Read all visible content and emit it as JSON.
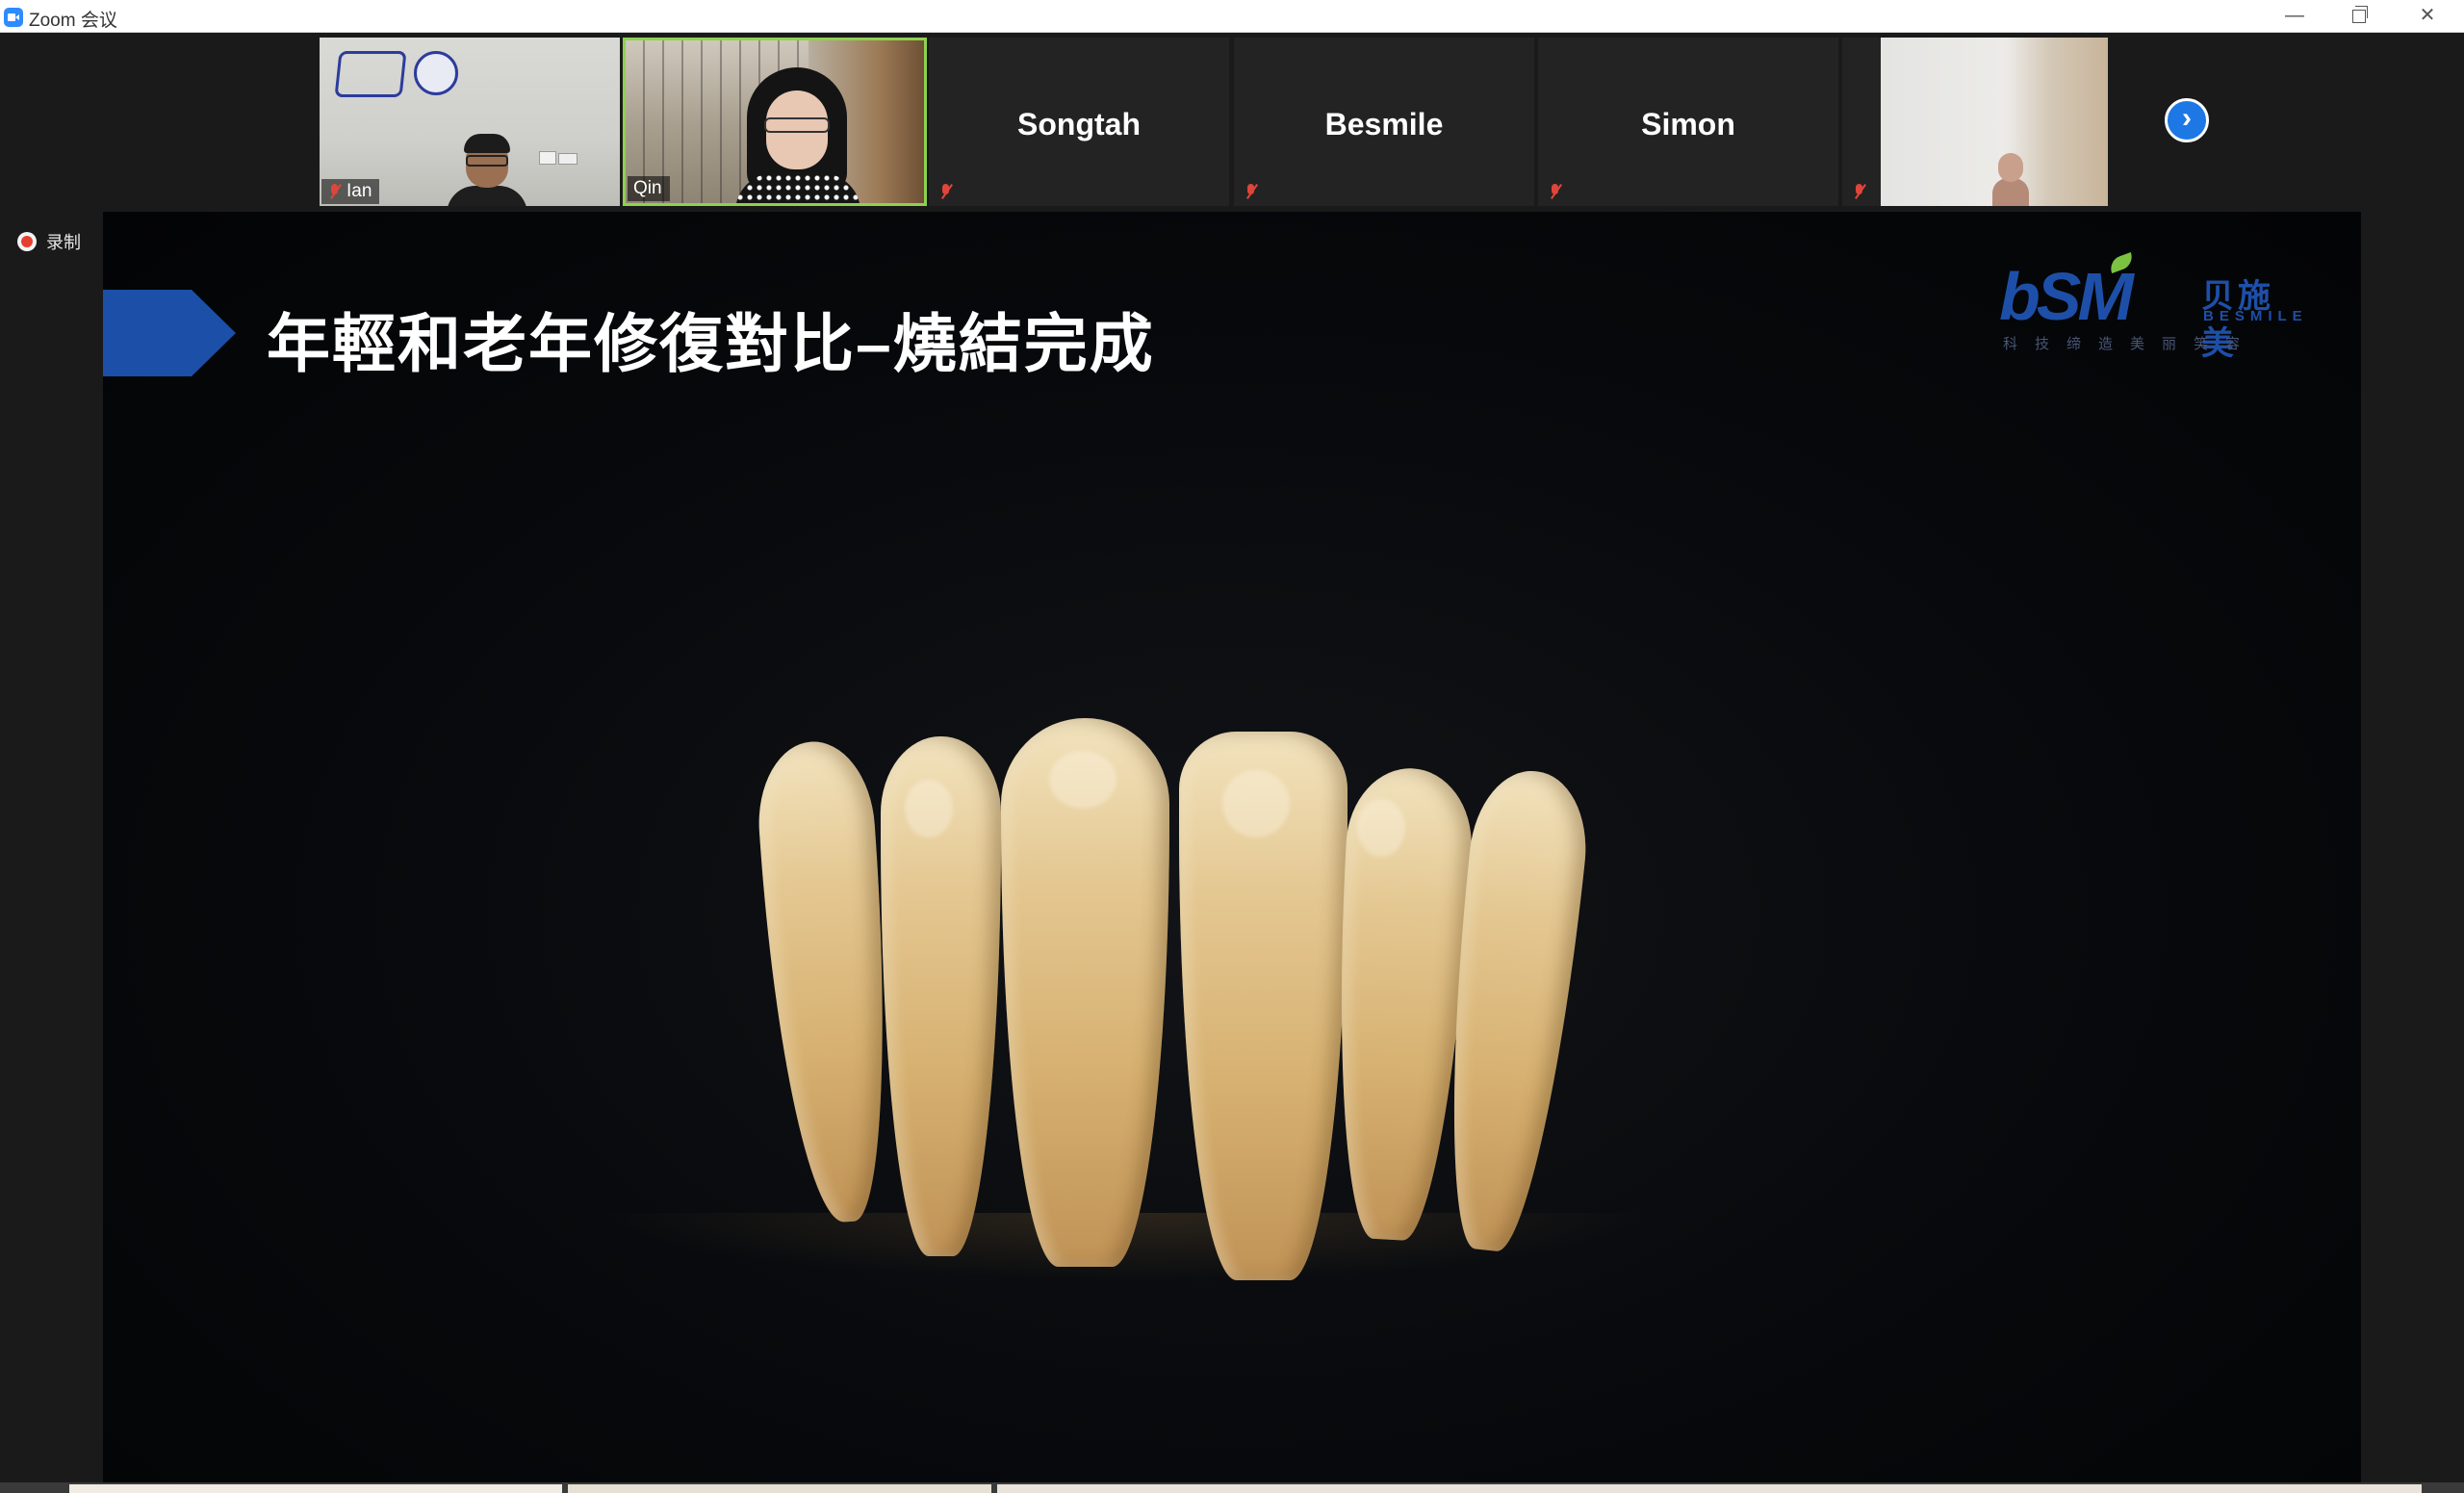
{
  "window": {
    "title": "Zoom 会议"
  },
  "gallery": {
    "participants": [
      {
        "name": "Ian",
        "muted": true
      },
      {
        "name": "Qin",
        "muted": false,
        "active_speaker": true
      },
      {
        "name": "Songtah",
        "muted": true
      },
      {
        "name": "Besmile",
        "muted": true
      },
      {
        "name": "Simon",
        "muted": true
      },
      {
        "name": "",
        "muted": true
      }
    ],
    "next_page": "›"
  },
  "recording": {
    "label": "录制"
  },
  "slide": {
    "title": "年輕和老年修復對比–燒結完成",
    "brand": {
      "mark": "bSM",
      "name_cn": "贝施美",
      "name_en": "BESMILE",
      "slogan": "科技缔造美丽笑容"
    },
    "image": "dental-crown-teeth-model"
  },
  "colors": {
    "accent_blue": "#1b4fa8",
    "active_speaker_border": "#8fd14f",
    "muted_red": "#e0453a",
    "next_button": "#1d78e6"
  }
}
